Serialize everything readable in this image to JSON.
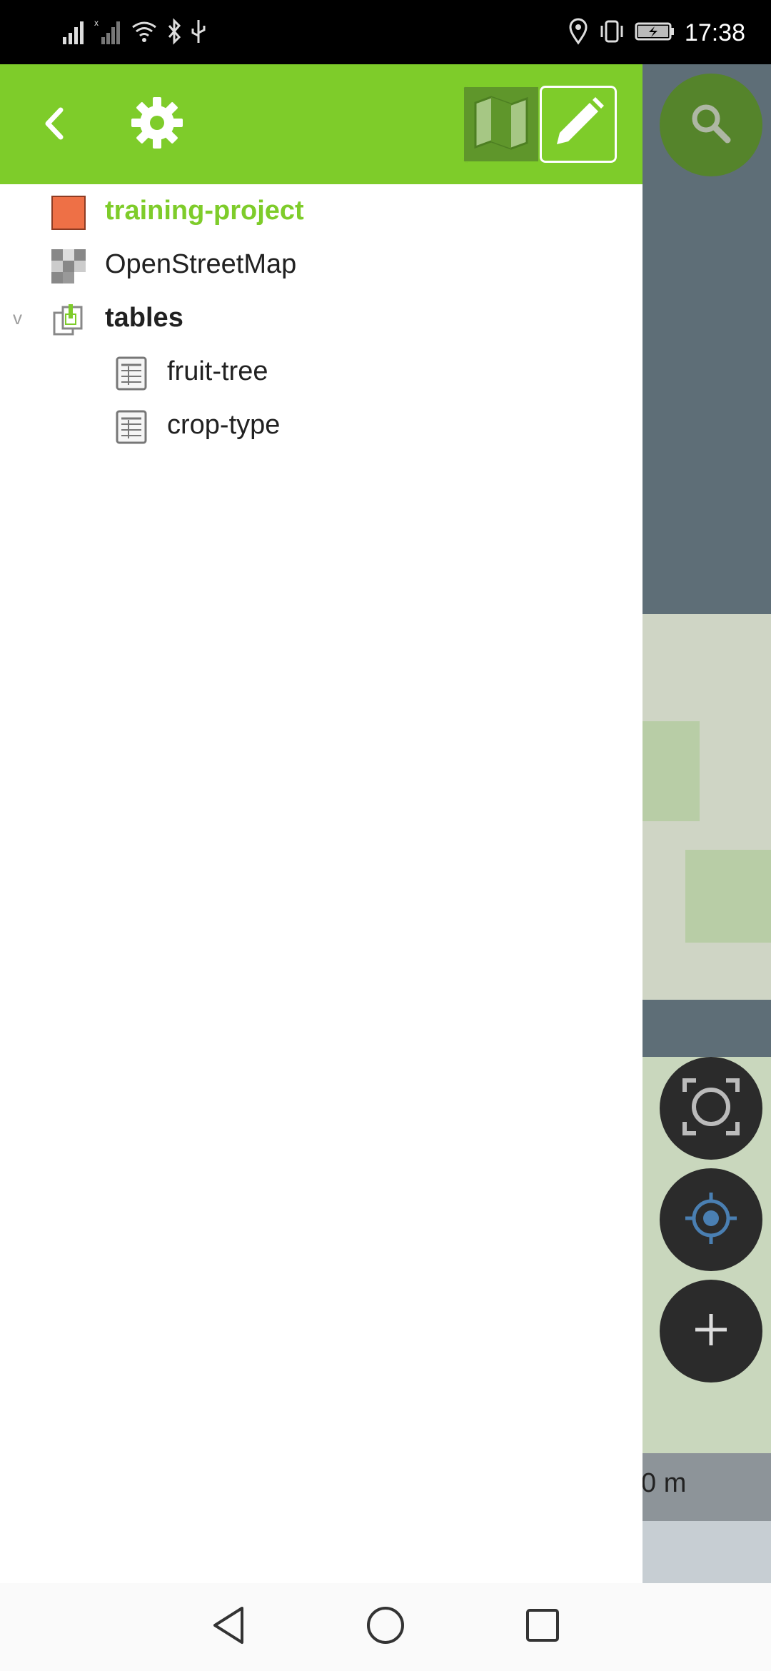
{
  "status_bar": {
    "time": "17:38",
    "icons": [
      "signal-icon",
      "signal-no-sim-icon",
      "wifi-icon",
      "bluetooth-icon",
      "usb-icon",
      "location-icon",
      "vibrate-icon",
      "battery-charging-icon"
    ]
  },
  "header": {
    "back_icon": "chevron-left-icon",
    "settings_icon": "gear-icon",
    "mode_map_icon": "map-icon",
    "mode_edit_icon": "pencil-icon",
    "accent_color": "#7ecc2a"
  },
  "layers": {
    "project": {
      "label": "training-project",
      "color": "#ee7046"
    },
    "basemap": {
      "label": "OpenStreetMap"
    },
    "group": {
      "label": "tables",
      "expander": "v",
      "children": [
        {
          "label": "fruit-tree"
        },
        {
          "label": "crop-type"
        }
      ]
    }
  },
  "map": {
    "scale_text": "0 m"
  },
  "fabs": {
    "search_icon": "search-icon",
    "zoom_icon": "zoom-extent-icon",
    "gps_icon": "gps-icon",
    "add_icon": "plus-icon"
  },
  "nav": {
    "back_icon": "nav-back-icon",
    "home_icon": "nav-home-icon",
    "recents_icon": "nav-recents-icon"
  }
}
